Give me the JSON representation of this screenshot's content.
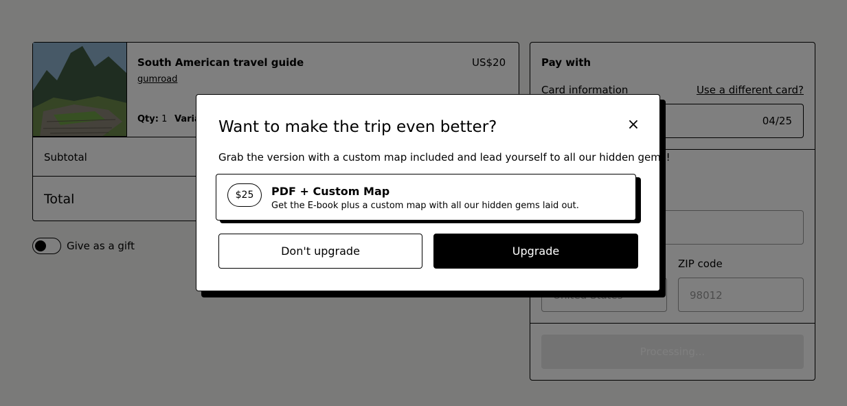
{
  "cart": {
    "product_name": "South American travel guide",
    "seller": "gumroad",
    "price": "US$20",
    "qty_label": "Qty:",
    "qty_value": "1",
    "variant_label": "Varia",
    "subtotal_label": "Subtotal",
    "total_label": "Total"
  },
  "gift": {
    "label": "Give as a gift"
  },
  "payment": {
    "title": "Pay with",
    "card_label": "Card information",
    "different_card": "Use a different card?",
    "card_expiry": "04/25",
    "country_value": "United States",
    "zip_label": "ZIP code",
    "zip_placeholder": "98012",
    "submit_label": "Processing..."
  },
  "modal": {
    "title": "Want to make the trip even better?",
    "close_glyph": "×",
    "description": "Grab the version with a custom map included and lead yourself to all our hidden gems!",
    "option": {
      "price": "$25",
      "title": "PDF + Custom Map",
      "description": "Get the E-book plus a custom map with all our hidden gems laid out."
    },
    "decline_label": "Don't upgrade",
    "accept_label": "Upgrade"
  }
}
